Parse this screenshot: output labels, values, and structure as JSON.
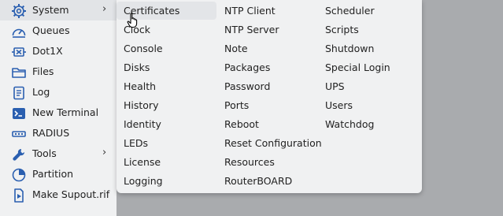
{
  "sidebar": {
    "items": [
      {
        "label": "System",
        "icon": "gear-icon",
        "has_submenu": true
      },
      {
        "label": "Queues",
        "icon": "gauge-icon",
        "has_submenu": false
      },
      {
        "label": "Dot1X",
        "icon": "dot1x-icon",
        "has_submenu": false
      },
      {
        "label": "Files",
        "icon": "folder-icon",
        "has_submenu": false
      },
      {
        "label": "Log",
        "icon": "log-icon",
        "has_submenu": false
      },
      {
        "label": "New Terminal",
        "icon": "terminal-icon",
        "has_submenu": false
      },
      {
        "label": "RADIUS",
        "icon": "radius-icon",
        "has_submenu": false
      },
      {
        "label": "Tools",
        "icon": "tools-icon",
        "has_submenu": true
      },
      {
        "label": "Partition",
        "icon": "partition-icon",
        "has_submenu": false
      },
      {
        "label": "Make Supout.rif",
        "icon": "supout-icon",
        "has_submenu": false
      }
    ],
    "chevron": "›"
  },
  "submenu": {
    "col1": [
      "Certificates",
      "Clock",
      "Console",
      "Disks",
      "Health",
      "History",
      "Identity",
      "LEDs",
      "License",
      "Logging"
    ],
    "col2": [
      "NTP Client",
      "NTP Server",
      "Note",
      "Packages",
      "Password",
      "Ports",
      "Reboot",
      "Reset Configuration",
      "Resources",
      "RouterBOARD"
    ],
    "col3": [
      "Scheduler",
      "Scripts",
      "Shutdown",
      "Special Login",
      "UPS",
      "Users",
      "Watchdog"
    ]
  },
  "colors": {
    "icon": "#2a5fb0",
    "background": "#a9abae",
    "menu": "#f0f1f2"
  }
}
